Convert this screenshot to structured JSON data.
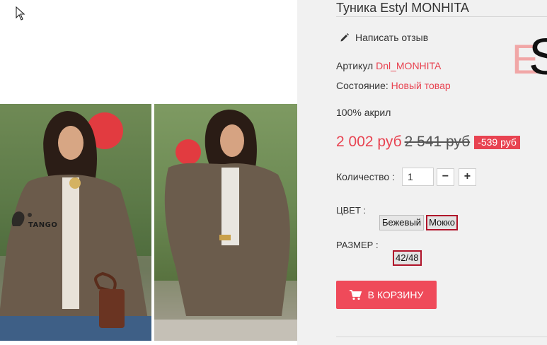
{
  "product": {
    "title": "Туника Estyl MONHITA",
    "review_label": "Написать отзыв",
    "article_label": "Артикул",
    "article_value": "Dnl_MONHITA",
    "condition_label": "Состояние:",
    "condition_value": "Новый товар",
    "material": "100% акрил",
    "brand_logo": {
      "letter_e": "E",
      "letter_s": "S"
    }
  },
  "pricing": {
    "current": "2 002 руб",
    "old": "2 541 руб",
    "discount": "-539 руб"
  },
  "quantity": {
    "label": "Количество :",
    "value": "1",
    "minus": "−",
    "plus": "+"
  },
  "options": {
    "color_label": "ЦВЕТ :",
    "colors": [
      {
        "label": "Бежевый",
        "selected": false
      },
      {
        "label": "Мокко",
        "selected": true
      }
    ],
    "size_label": "РАЗМЕР :",
    "sizes": [
      {
        "label": "42/48",
        "selected": true
      }
    ]
  },
  "cart": {
    "label": "В КОРЗИНУ"
  },
  "gallery": {
    "watermark": "TANGO",
    "icons": [
      "mouse-cursor-icon",
      "pencil-icon",
      "shopping-cart-icon"
    ]
  },
  "colors": {
    "accent": "#e84351",
    "cart_button": "#ef4a5a",
    "selected_border": "#b0142a",
    "panel_bg": "#f1f1f1"
  }
}
